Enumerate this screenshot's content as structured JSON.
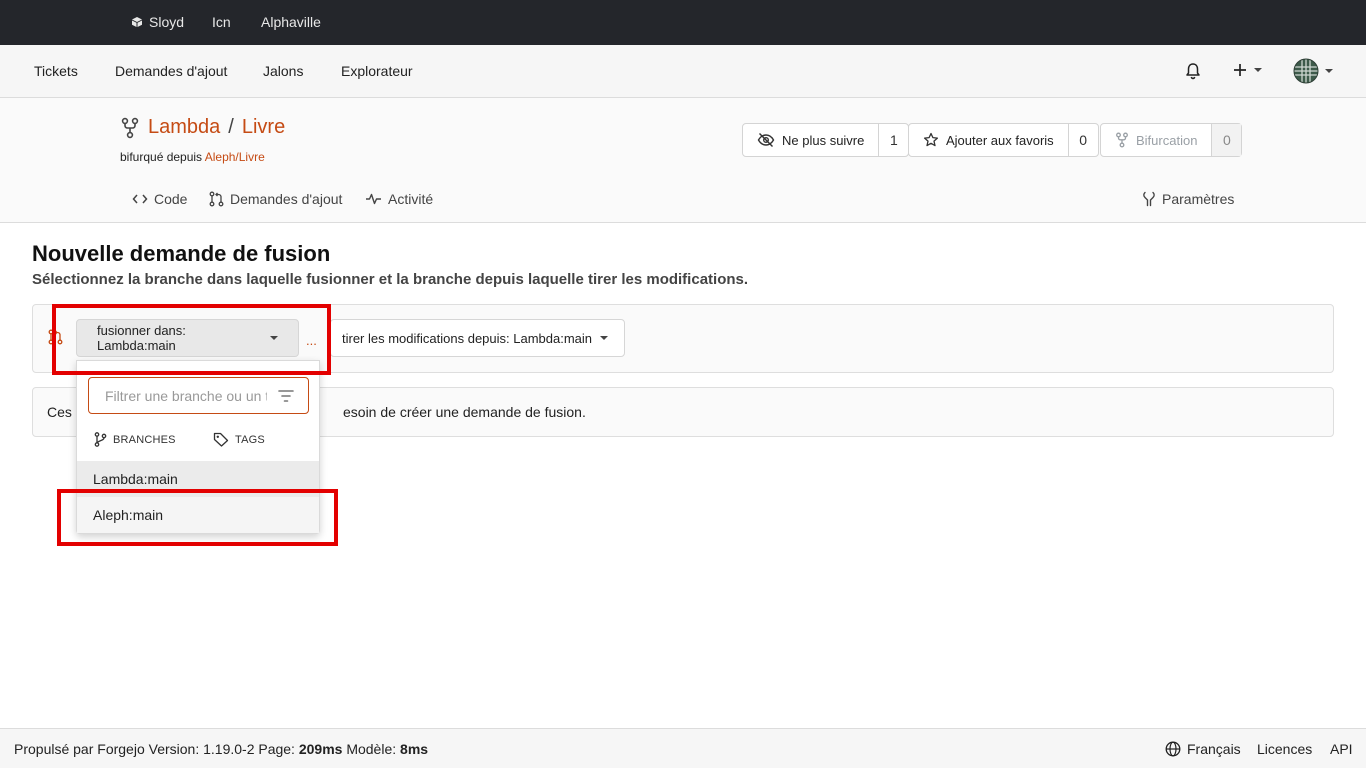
{
  "topbar": {
    "items": [
      {
        "label": "Sloyd",
        "icon": "box-icon"
      },
      {
        "label": "Icn"
      },
      {
        "label": "Alphaville"
      }
    ]
  },
  "nav": {
    "links": [
      "Tickets",
      "Demandes d'ajout",
      "Jalons",
      "Explorateur"
    ],
    "icons": [
      "bell-icon",
      "plus-icon",
      "globe-avatar-icon"
    ]
  },
  "repo": {
    "owner": "Lambda",
    "separator": "/",
    "name": "Livre",
    "forked_prefix": "bifurqué depuis",
    "forked_from": "Aleph/Livre",
    "watch": {
      "label": "Ne plus suivre",
      "count": "1"
    },
    "star": {
      "label": "Ajouter aux favoris",
      "count": "0"
    },
    "fork": {
      "label": "Bifurcation",
      "count": "0"
    },
    "tabs": [
      {
        "label": "Code",
        "icon": "code-icon"
      },
      {
        "label": "Demandes d'ajout",
        "icon": "pull-request-icon"
      },
      {
        "label": "Activité",
        "icon": "pulse-icon"
      }
    ],
    "settings_label": "Paramètres"
  },
  "main": {
    "title": "Nouvelle demande de fusion",
    "subtitle": "Sélectionnez la branche dans laquelle fusionner et la branche depuis laquelle tirer les modifications.",
    "base_branch_label": "fusionner dans: Lambda:main",
    "ellipsis": "...",
    "head_branch_label": "tirer les modifications depuis: Lambda:main",
    "message_start": "Ces",
    "message_end": "esoin de créer une demande de fusion."
  },
  "dropdown": {
    "filter_placeholder": "Filtrer une branche ou un tag",
    "tab_branches": "BRANCHES",
    "tab_tags": "TAGS",
    "options": [
      "Lambda:main",
      "Aleph:main"
    ]
  },
  "footer": {
    "powered": "Propulsé par Forgejo Version: 1.19.0-2 Page: ",
    "page_time": "209ms",
    "template_label": " Modèle: ",
    "template_time": "8ms",
    "language": "Français",
    "licenses": "Licences",
    "api": "API"
  },
  "colors": {
    "accent": "#c54b14",
    "topbar": "#24262b",
    "highlight": "#e30000"
  }
}
